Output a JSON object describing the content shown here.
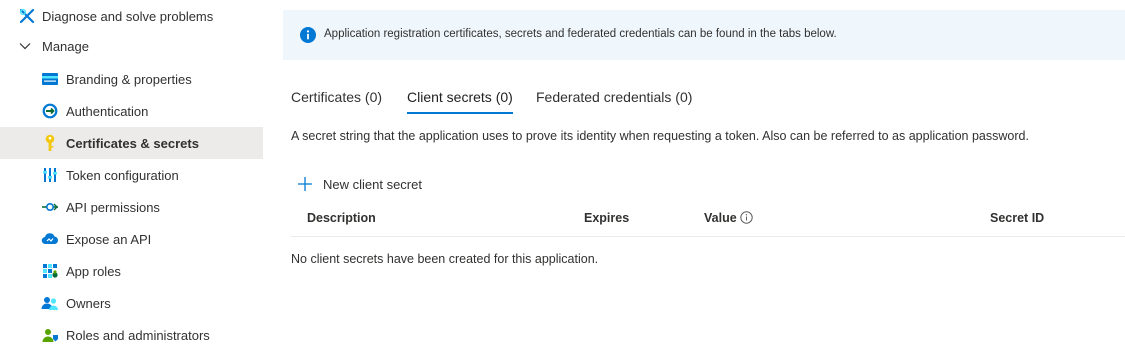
{
  "sidebar": {
    "items": [
      {
        "label": "Diagnose and solve problems",
        "icon": "wrench-icon"
      },
      {
        "label": "Manage",
        "icon": "chevron-down-icon"
      },
      {
        "label": "Branding & properties",
        "icon": "branding-icon"
      },
      {
        "label": "Authentication",
        "icon": "authentication-icon"
      },
      {
        "label": "Certificates & secrets",
        "icon": "key-icon",
        "selected": true
      },
      {
        "label": "Token configuration",
        "icon": "token-config-icon"
      },
      {
        "label": "API permissions",
        "icon": "api-permissions-icon"
      },
      {
        "label": "Expose an API",
        "icon": "cloud-icon"
      },
      {
        "label": "App roles",
        "icon": "app-roles-icon"
      },
      {
        "label": "Owners",
        "icon": "owners-icon"
      },
      {
        "label": "Roles and administrators",
        "icon": "roles-admin-icon"
      }
    ]
  },
  "info_bar": {
    "text": "Application registration certificates, secrets and federated credentials can be found in the tabs below.",
    "icon": "info-icon"
  },
  "tabs": [
    {
      "label": "Certificates (0)"
    },
    {
      "label": "Client secrets (0)",
      "active": true
    },
    {
      "label": "Federated credentials (0)"
    }
  ],
  "description": "A secret string that the application uses to prove its identity when requesting a token. Also can be referred to as application password.",
  "new_secret_label": "New client secret",
  "table": {
    "columns": [
      "Description",
      "Expires",
      "Value",
      "Secret ID"
    ],
    "empty_message": "No client secrets have been created for this application."
  },
  "colors": {
    "accent": "#0078d4",
    "selected_bg": "#edebe9",
    "info_bg": "#eff6fc"
  }
}
